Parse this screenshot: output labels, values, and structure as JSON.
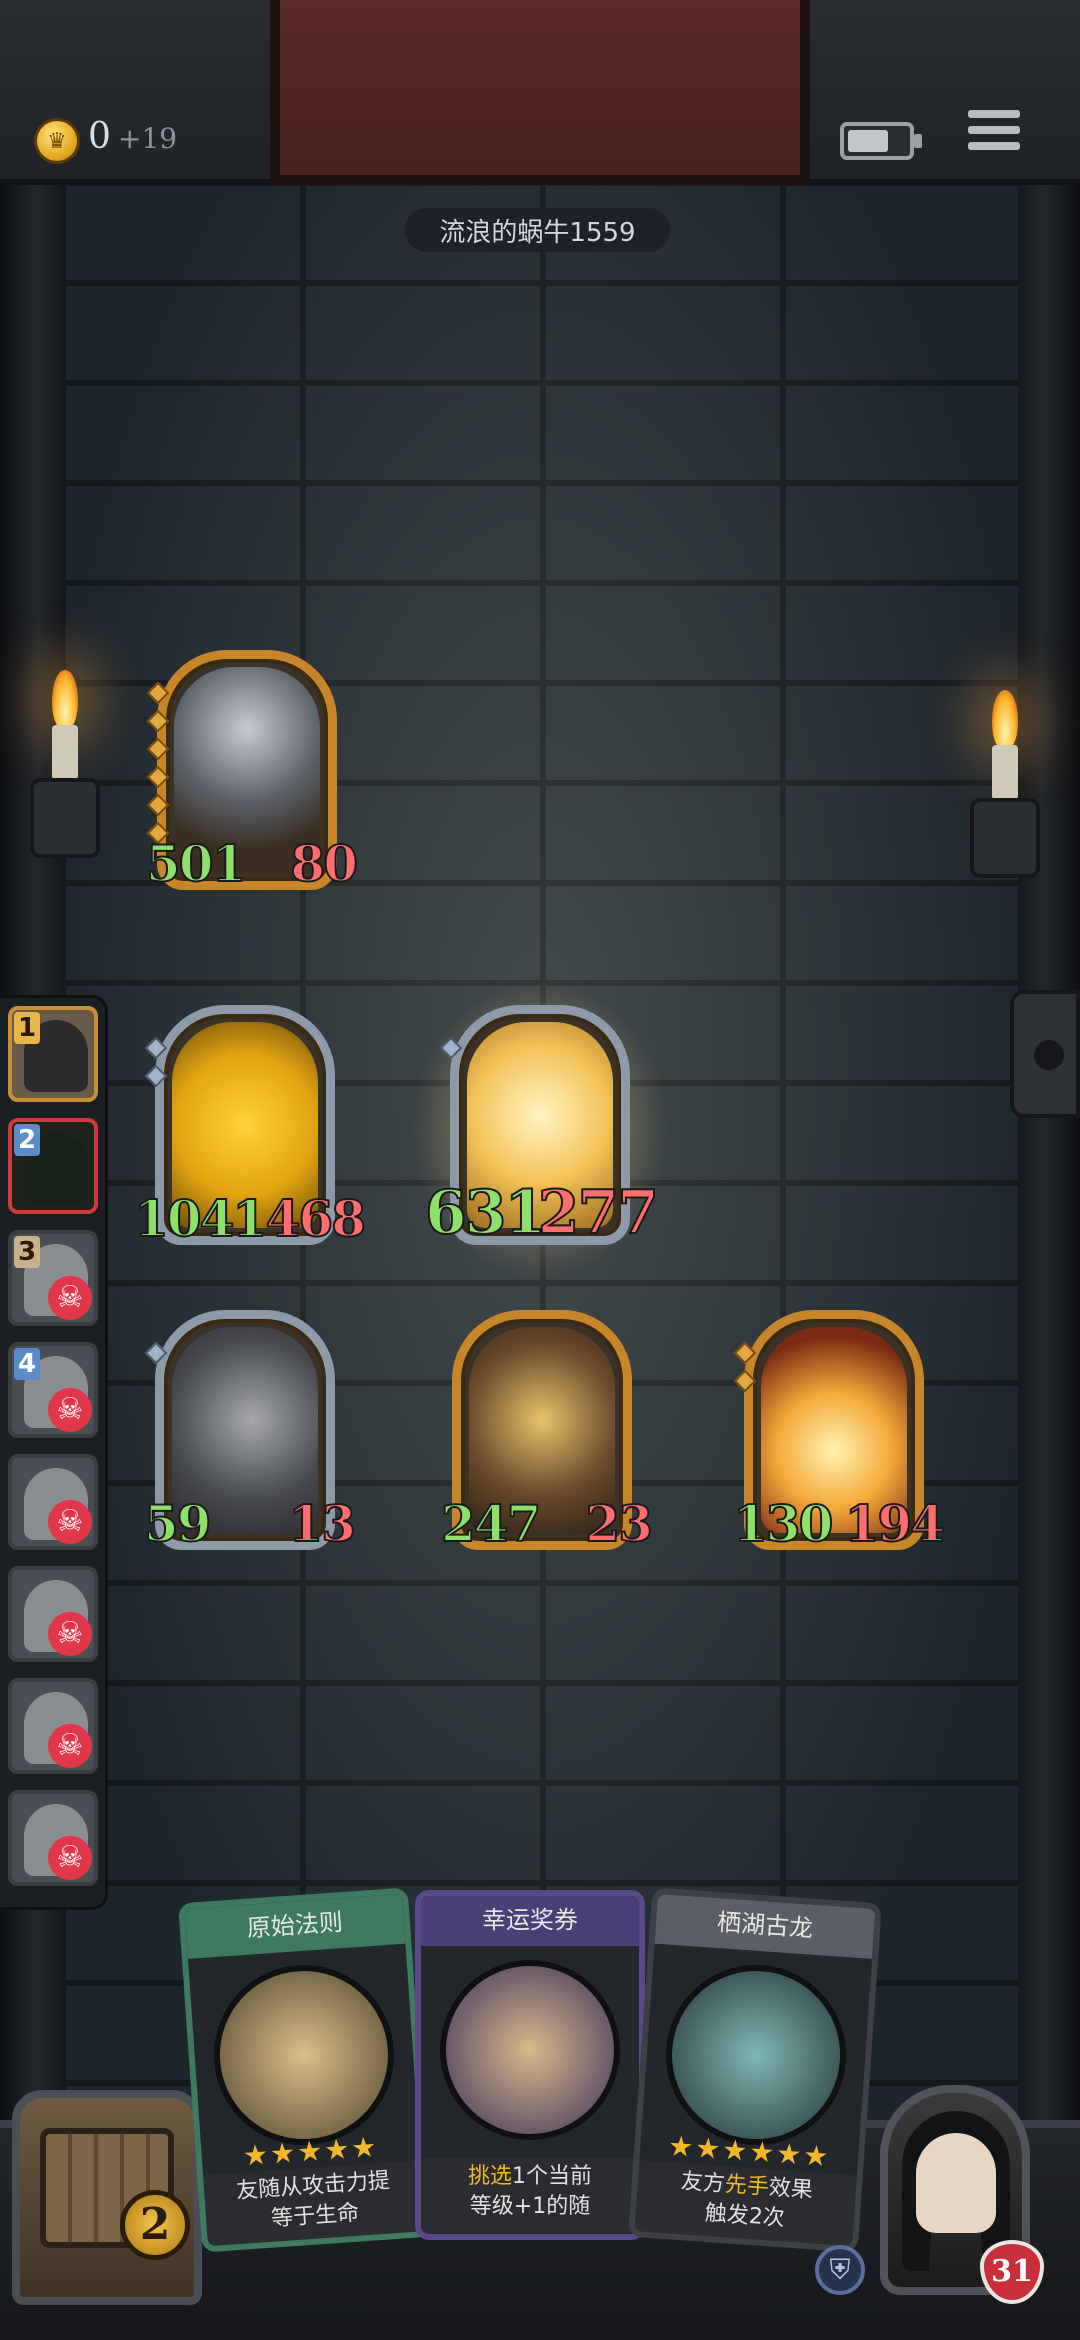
{
  "header": {
    "coins": "0",
    "coin_bonus": "+19",
    "player_name": "流浪的蜗牛1559"
  },
  "icons": {
    "coin": "crown-coin-icon",
    "battery": "battery-icon",
    "menu": "hamburger-menu-icon",
    "skull": "skull-crossbones-icon",
    "shield": "shield-icon",
    "heart": "heart-icon"
  },
  "enemy_board": [
    {
      "name": "knight",
      "attack": "501",
      "health": "80"
    }
  ],
  "player_board": [
    {
      "name": "golden-dragon",
      "attack": "1041",
      "health": "468"
    },
    {
      "name": "radiant-angel",
      "attack": "631",
      "health": "277"
    },
    {
      "name": "dark-dragon",
      "attack": "59",
      "health": "13"
    },
    {
      "name": "dark-priestess",
      "attack": "247",
      "health": "23"
    },
    {
      "name": "explosive-beast",
      "attack": "130",
      "health": "194"
    }
  ],
  "opponents": [
    {
      "rank": "1",
      "status": "current"
    },
    {
      "rank": "2",
      "status": "active"
    },
    {
      "rank": "3",
      "status": "eliminated"
    },
    {
      "rank": "4",
      "status": "eliminated"
    },
    {
      "rank": "",
      "status": "eliminated"
    },
    {
      "rank": "",
      "status": "eliminated"
    },
    {
      "rank": "",
      "status": "eliminated"
    },
    {
      "rank": "",
      "status": "eliminated"
    }
  ],
  "hand": [
    {
      "title": "原始法则",
      "stars": "★★★★★",
      "desc_line1": "友随从攻击力提",
      "desc_line2": "等于生命",
      "border": "#3e7a5f"
    },
    {
      "title": "幸运奖券",
      "stars": "",
      "desc_pre": "挑选",
      "desc_mid": "1个当前",
      "desc_line2": "等级+1的随",
      "border": "#5a4a8a"
    },
    {
      "title": "栖湖古龙",
      "stars": "★★★★★★",
      "desc_pre": "友方",
      "desc_hl": "先手",
      "desc_post": "效果",
      "desc_line2": "触发2次",
      "border": "#3d4147"
    }
  ],
  "chest_level": "2",
  "hero_health": "31",
  "colors": {
    "attack": "#8fe06a",
    "health": "#ff6e6e",
    "gold_frame": "#c8862a",
    "silver_frame": "#8d9aaa"
  }
}
